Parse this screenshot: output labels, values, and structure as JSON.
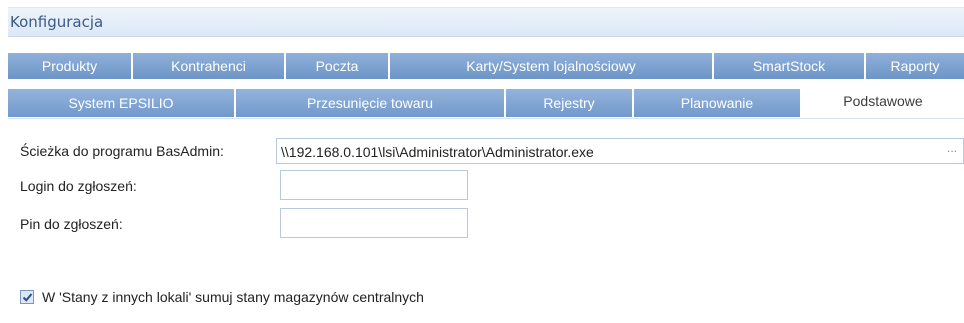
{
  "window": {
    "title": "Konfiguracja"
  },
  "tabs_row1": [
    {
      "label": "Produkty"
    },
    {
      "label": "Kontrahenci"
    },
    {
      "label": "Poczta"
    },
    {
      "label": "Karty/System lojalnościowy"
    },
    {
      "label": "SmartStock"
    },
    {
      "label": "Raporty"
    }
  ],
  "tabs_row2": [
    {
      "label": "System EPSILIO"
    },
    {
      "label": "Przesunięcie towaru"
    },
    {
      "label": "Rejestry"
    },
    {
      "label": "Planowanie"
    },
    {
      "label": "Podstawowe",
      "active": true
    }
  ],
  "form": {
    "basadmin_label": "Ścieżka do programu BasAdmin:",
    "basadmin_value": "\\\\192.168.0.101\\lsi\\Administrator\\Administrator.exe",
    "browse_label": "...",
    "login_label": "Login do zgłoszeń:",
    "login_value": "",
    "pin_label": "Pin do zgłoszeń:",
    "pin_value": "",
    "checkbox_label": "W 'Stany z innych lokali' sumuj stany magazynów centralnych",
    "checkbox_checked": true
  }
}
